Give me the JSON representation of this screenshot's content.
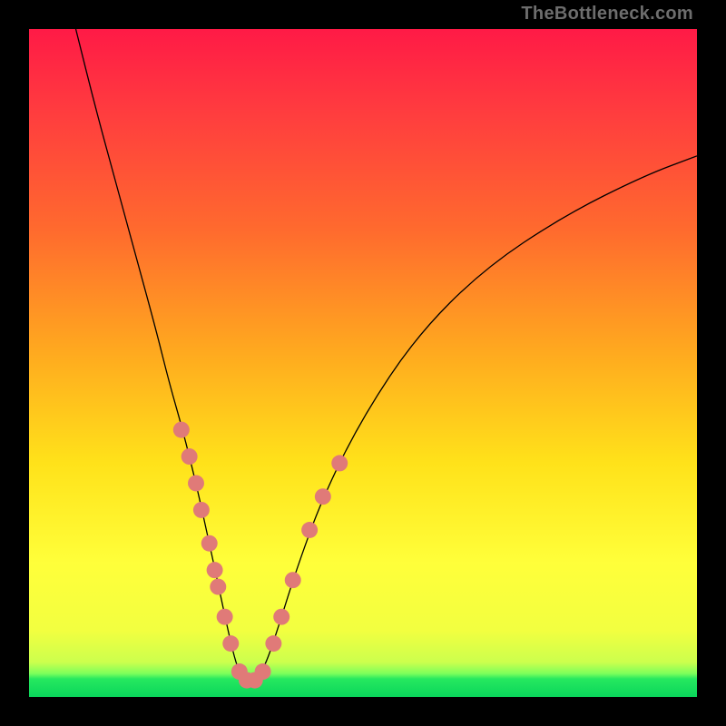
{
  "watermark": {
    "text": "TheBottleneck.com"
  },
  "chart_data": {
    "type": "line",
    "title": "",
    "xlabel": "",
    "ylabel": "",
    "xlim": [
      0,
      100
    ],
    "ylim": [
      0,
      100
    ],
    "grid": false,
    "legend": false,
    "series": [
      {
        "name": "curve",
        "x": [
          7,
          10,
          13,
          16,
          19,
          21,
          23,
          25,
          27,
          28.5,
          30,
          31,
          32,
          33,
          34,
          35.5,
          37.5,
          40,
          44,
          50,
          58,
          68,
          80,
          92,
          100
        ],
        "y": [
          100,
          88,
          77,
          66,
          55,
          47,
          40,
          32,
          23,
          16,
          9,
          5,
          2.5,
          2.3,
          2.5,
          5,
          11,
          19,
          30,
          42,
          54,
          64,
          72,
          78,
          81
        ]
      }
    ],
    "markers": [
      {
        "name": "dots",
        "color": "#e07a78",
        "radius": 9,
        "points": [
          [
            22.8,
            40
          ],
          [
            24,
            36
          ],
          [
            25,
            32
          ],
          [
            25.8,
            28
          ],
          [
            27,
            23
          ],
          [
            27.8,
            19
          ],
          [
            28.3,
            16.5
          ],
          [
            29.3,
            12
          ],
          [
            30.2,
            8
          ],
          [
            31.5,
            3.8
          ],
          [
            32.6,
            2.5
          ],
          [
            33.8,
            2.5
          ],
          [
            35,
            3.8
          ],
          [
            36.6,
            8
          ],
          [
            37.8,
            12
          ],
          [
            39.5,
            17.5
          ],
          [
            42,
            25
          ],
          [
            44,
            30
          ],
          [
            46.5,
            35
          ]
        ]
      }
    ]
  }
}
